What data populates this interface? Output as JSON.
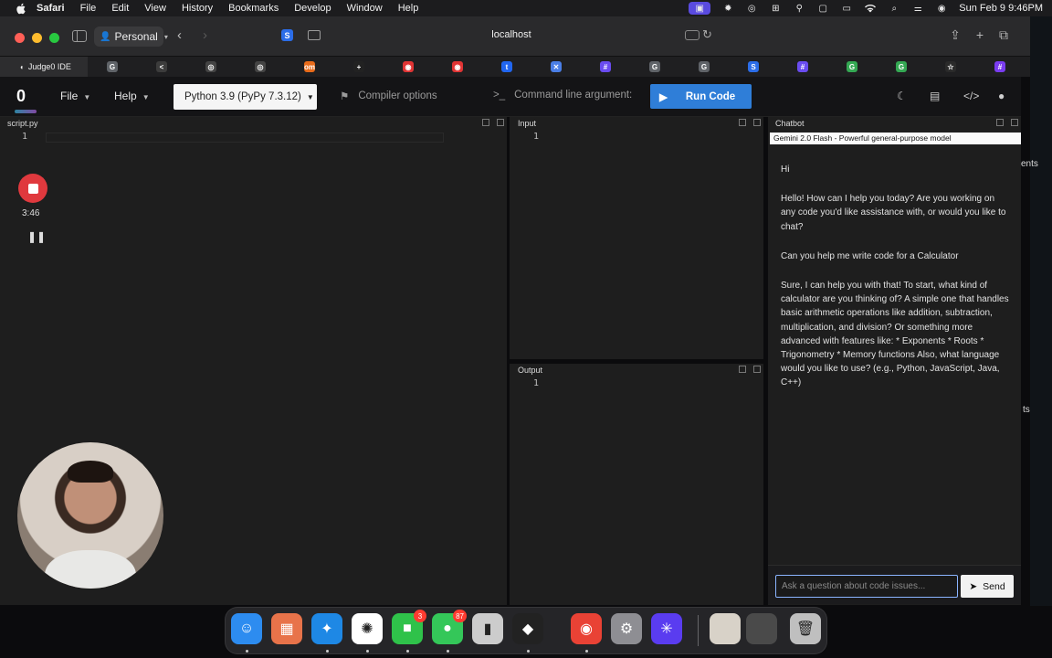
{
  "menubar": {
    "app": "Safari",
    "items": [
      "File",
      "Edit",
      "View",
      "History",
      "Bookmarks",
      "Develop",
      "Window",
      "Help"
    ],
    "clock": "Sun Feb 9  9:46PM"
  },
  "safari": {
    "profile": "Personal",
    "address": "localhost",
    "active_tab": "Judge0 IDE",
    "tab_favicons": [
      {
        "icon": "google-g-icon",
        "color": "#5f6368",
        "glyph": "G"
      },
      {
        "icon": "code-icon",
        "color": "#3c3c3c",
        "glyph": "<"
      },
      {
        "icon": "openai-icon",
        "color": "#444",
        "glyph": "◎"
      },
      {
        "icon": "openai-icon",
        "color": "#444",
        "glyph": "◎"
      },
      {
        "icon": "om-icon",
        "color": "#e86b1a",
        "glyph": "om"
      },
      {
        "icon": "plus-square-icon",
        "color": "#222",
        "glyph": "+"
      },
      {
        "icon": "shield-icon",
        "color": "#e03434",
        "glyph": "◉"
      },
      {
        "icon": "shield-icon",
        "color": "#e03434",
        "glyph": "◉"
      },
      {
        "icon": "t-icon",
        "color": "#2166f0",
        "glyph": "t"
      },
      {
        "icon": "cross-icon",
        "color": "#4a7ee6",
        "glyph": "✕"
      },
      {
        "icon": "slack-icon",
        "color": "#6a4cf0",
        "glyph": "#"
      },
      {
        "icon": "google-g-icon",
        "color": "#5f6368",
        "glyph": "G"
      },
      {
        "icon": "google-g-icon",
        "color": "#5f6368",
        "glyph": "G"
      },
      {
        "icon": "s-icon",
        "color": "#2b6de8",
        "glyph": "S"
      },
      {
        "icon": "slack-icon",
        "color": "#6a4cf0",
        "glyph": "#"
      },
      {
        "icon": "chrome-icon",
        "color": "#34a853",
        "glyph": "G"
      },
      {
        "icon": "chrome-icon",
        "color": "#34a853",
        "glyph": "G"
      },
      {
        "icon": "star-icon",
        "color": "#2a2a2a",
        "glyph": "☆"
      },
      {
        "icon": "slack-icon",
        "color": "#7a3cf0",
        "glyph": "#"
      }
    ]
  },
  "header": {
    "file_menu": "File",
    "help_menu": "Help",
    "language": "Python 3.9 (PyPy 7.3.12)",
    "compiler_options": "Compiler options",
    "command_line_args": "Command line argument:",
    "run_button": "Run Code"
  },
  "editor": {
    "filename": "script.py",
    "line": "1"
  },
  "input_panel": {
    "label": "Input",
    "line": "1"
  },
  "output_panel": {
    "label": "Output",
    "line": "1"
  },
  "recorder": {
    "time": "3:46"
  },
  "chatbot": {
    "label": "Chatbot",
    "model": "Gemini 2.0 Flash - Powerful general-purpose model",
    "messages": [
      "Hi",
      "Hello! How can I help you today? Are you working on any code you'd like assistance with, or would you like to chat?",
      "Can you help me write code for a Calculator",
      "Sure, I can help you with that! To start, what kind of calculator are you thinking of? A simple one that handles basic arithmetic operations like addition, subtraction, multiplication, and division? Or something more advanced with features like: * Exponents * Roots * Trigonometry * Memory functions Also, what language would you like to use? (e.g., Python, JavaScript, Java, C++)"
    ],
    "input_placeholder": "Ask a question about code issues...",
    "send_button": "Send"
  },
  "behind_window": {
    "text_top": "ents",
    "text_bottom": "ts"
  },
  "dock": {
    "apps": [
      {
        "name": "finder-icon",
        "color": "#2d8cf0",
        "glyph": "☺"
      },
      {
        "name": "launchpad-icon",
        "color": "#e8734a",
        "glyph": "▦"
      },
      {
        "name": "safari-icon",
        "color": "#1e88e5",
        "glyph": "✦"
      },
      {
        "name": "chatgpt-icon",
        "color": "#ffffff",
        "glyph": "✺"
      },
      {
        "name": "facetime-icon",
        "color": "#2fc24a",
        "glyph": "■",
        "badge": "3"
      },
      {
        "name": "messages-icon",
        "color": "#34c759",
        "glyph": "●",
        "badge": "87"
      },
      {
        "name": "tool-icon",
        "color": "#cccccc",
        "glyph": "▮"
      },
      {
        "name": "unity-icon",
        "color": "#222222",
        "glyph": "◆"
      },
      {
        "name": "chrome-icon",
        "color": "#e94235",
        "glyph": "◉"
      },
      {
        "name": "system-settings-icon",
        "color": "#8e8e93",
        "glyph": "⚙"
      },
      {
        "name": "perplexity-icon",
        "color": "#5a3cf0",
        "glyph": "✳"
      },
      {
        "name": "photo-thumbnail-icon",
        "color": "#d8d2c8",
        "glyph": ""
      },
      {
        "name": "downloads-stack-icon",
        "color": "#4a4a4a",
        "glyph": ""
      },
      {
        "name": "trash-icon",
        "color": "#bfbfbf",
        "glyph": "🗑"
      }
    ]
  }
}
